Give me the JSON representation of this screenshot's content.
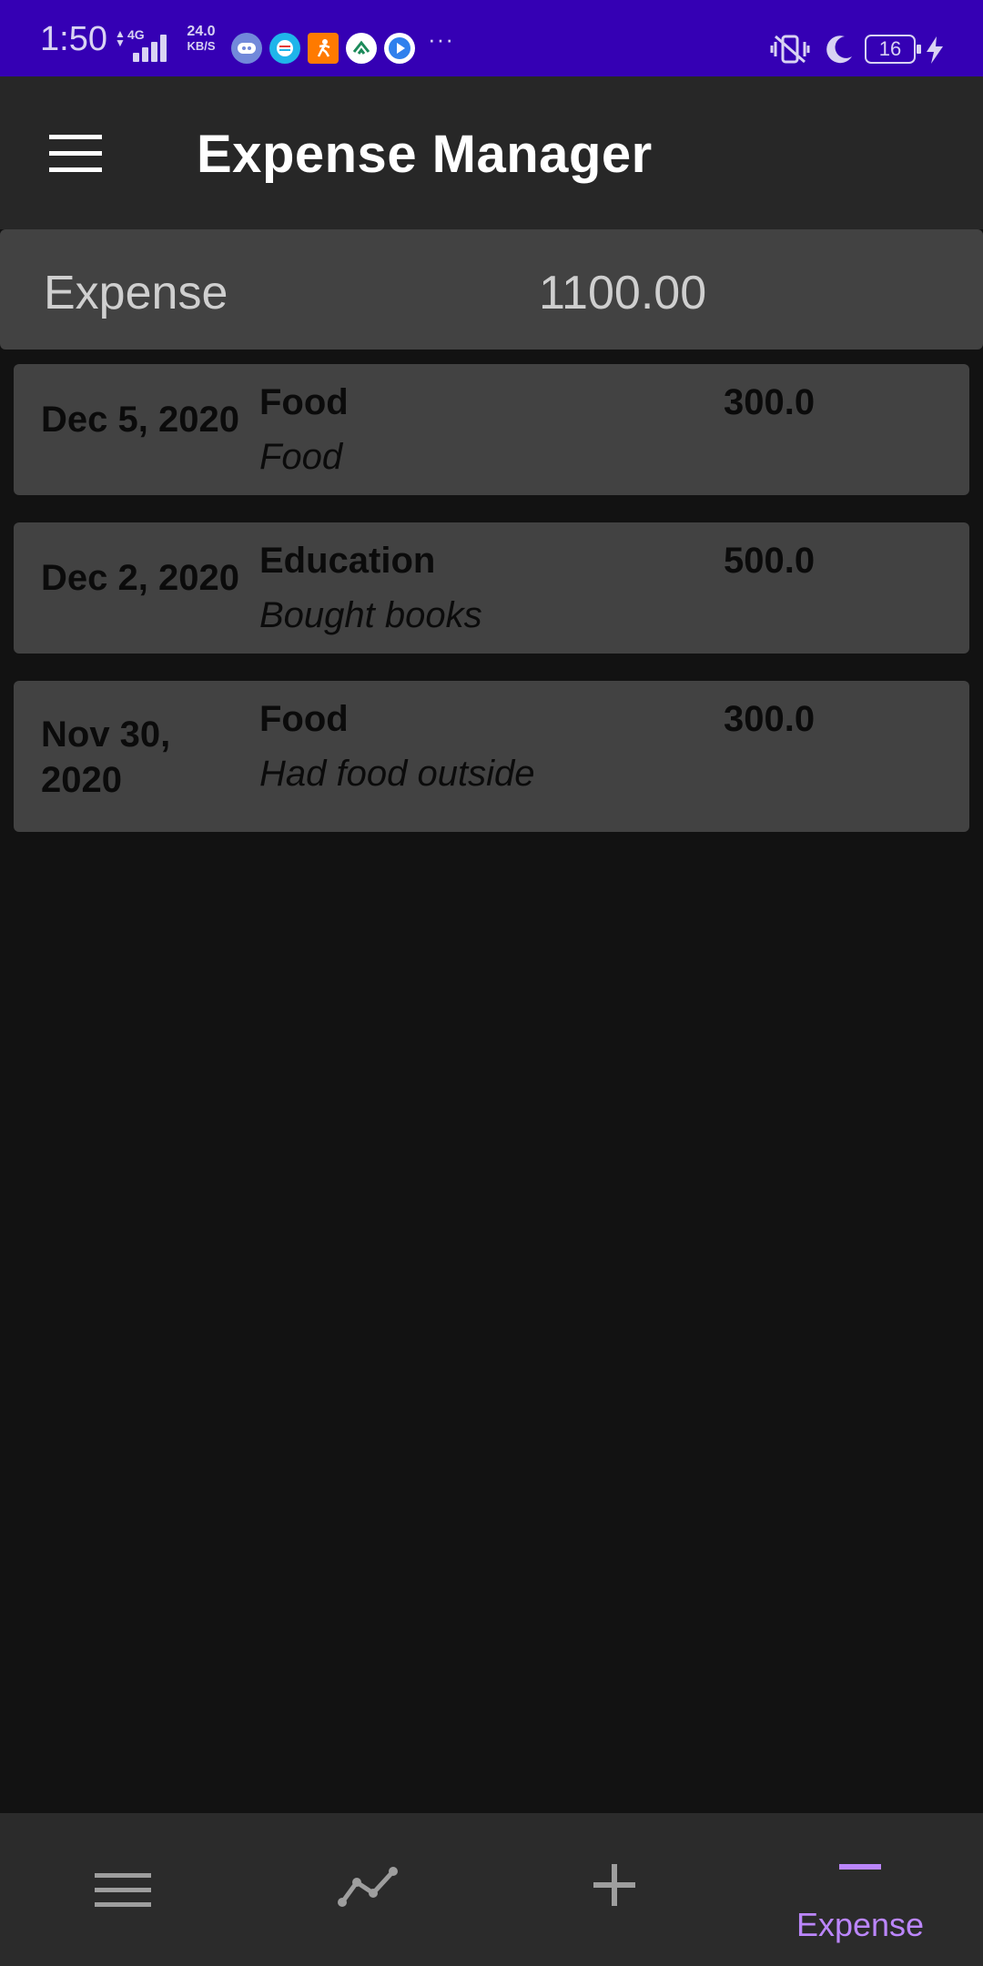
{
  "status_bar": {
    "time": "1:50",
    "network_type": "4G",
    "speed_value": "24.0",
    "speed_unit": "KB/S",
    "battery_level": "16",
    "colors": {
      "background": "#3500b4",
      "foreground": "#d9d3f3"
    }
  },
  "app_bar": {
    "title": "Expense Manager",
    "menu_icon": "hamburger-menu-icon"
  },
  "summary": {
    "label": "Expense",
    "value": "1100.00"
  },
  "expenses": [
    {
      "date": "Dec 5, 2020",
      "category": "Food",
      "note": "Food",
      "amount": "300.0"
    },
    {
      "date": "Dec 2, 2020",
      "category": "Education",
      "note": "Bought books",
      "amount": "500.0"
    },
    {
      "date": "Nov 30, 2020",
      "category": "Food",
      "note": "Had food outside",
      "amount": "300.0"
    }
  ],
  "bottom_nav": {
    "items": [
      {
        "icon": "list-icon",
        "label": ""
      },
      {
        "icon": "trend-icon",
        "label": ""
      },
      {
        "icon": "add-icon",
        "label": ""
      },
      {
        "icon": "minus-icon",
        "label": "Expense",
        "selected": true
      }
    ]
  },
  "colors": {
    "accent": "#bb86fc",
    "card": "#424242",
    "background": "#121212",
    "app_bar": "#272727"
  }
}
